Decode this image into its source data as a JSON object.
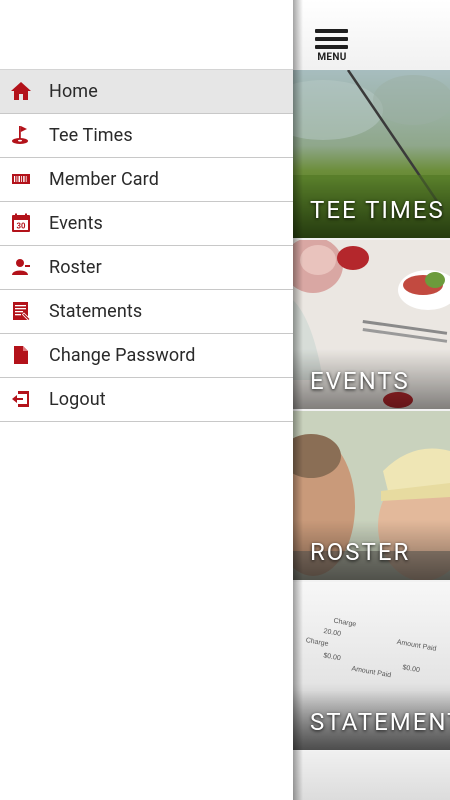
{
  "drawer": {
    "items": [
      {
        "label": "Home",
        "icon": "home-icon",
        "active": true
      },
      {
        "label": "Tee Times",
        "icon": "golf-flag-icon",
        "active": false
      },
      {
        "label": "Member Card",
        "icon": "barcode-card-icon",
        "active": false
      },
      {
        "label": "Events",
        "icon": "calendar-icon",
        "active": false
      },
      {
        "label": "Roster",
        "icon": "person-icon",
        "active": false
      },
      {
        "label": "Statements",
        "icon": "statement-document-icon",
        "active": false
      },
      {
        "label": "Change Password",
        "icon": "document-icon",
        "active": false
      },
      {
        "label": "Logout",
        "icon": "logout-icon",
        "active": false
      }
    ],
    "calendar_icon_text": "30"
  },
  "topbar": {
    "menu_label": "MENU",
    "menu_icon": "hamburger-icon"
  },
  "tiles": [
    {
      "caption": "TEE TIMES"
    },
    {
      "caption": "EVENTS"
    },
    {
      "caption": "ROSTER"
    },
    {
      "caption": "STATEMENTS"
    }
  ],
  "statement_image_text": {
    "charge_1": "Charge",
    "amount_1": "20.00",
    "amount_paid_1": "Amount Paid",
    "charge_2": "Charge",
    "amount_2": "$0.00",
    "amount_paid_2": "Amount Paid",
    "paid_value": "$0.00"
  },
  "colors": {
    "accent": "#b3121a",
    "drawer_bg": "#ffffff",
    "active_bg": "#e6e6e6",
    "divider": "#c8c8c8"
  }
}
